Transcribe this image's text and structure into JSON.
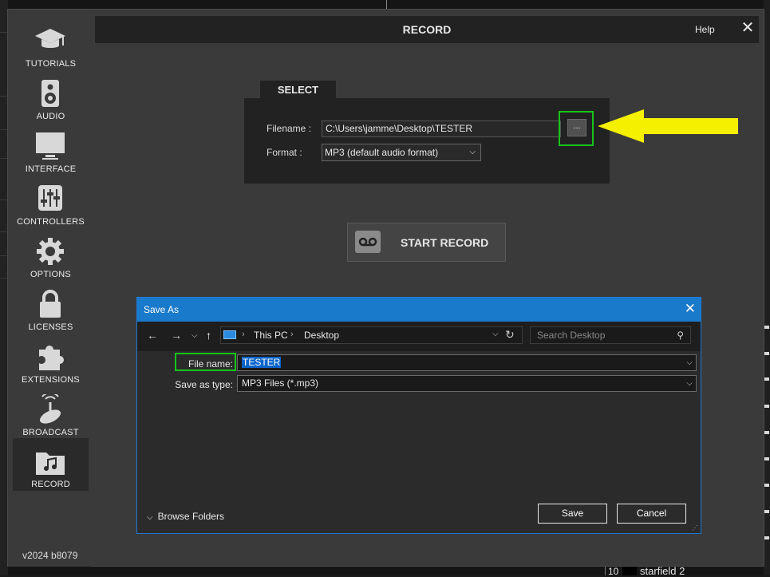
{
  "background": {
    "list_row": {
      "number": "10",
      "name": "starfield 2"
    }
  },
  "settings": {
    "title": "RECORD",
    "help": "Help",
    "close_glyph": "✕",
    "version": "v2024 b8079",
    "sidebar": [
      {
        "label": "TUTORIALS",
        "icon": "graduation-cap-icon"
      },
      {
        "label": "AUDIO",
        "icon": "speaker-icon"
      },
      {
        "label": "INTERFACE",
        "icon": "monitor-icon"
      },
      {
        "label": "CONTROLLERS",
        "icon": "sliders-icon"
      },
      {
        "label": "OPTIONS",
        "icon": "gear-icon"
      },
      {
        "label": "LICENSES",
        "icon": "lock-icon"
      },
      {
        "label": "EXTENSIONS",
        "icon": "puzzle-icon"
      },
      {
        "label": "BROADCAST",
        "icon": "satellite-dish-icon"
      },
      {
        "label": "RECORD",
        "icon": "music-folder-icon",
        "active": true
      }
    ],
    "select": {
      "tab": "SELECT",
      "filename_label": "Filename :",
      "filename_value": "C:\\Users\\jamme\\Desktop\\TESTER",
      "browse_label": "...",
      "format_label": "Format :",
      "format_value": "MP3 (default audio format)"
    },
    "start_record": "START RECORD",
    "annotation_color": "#f5ef00",
    "highlight_color": "#17c41b"
  },
  "save_as": {
    "title": "Save As",
    "close_glyph": "✕",
    "address": [
      "This PC",
      "Desktop"
    ],
    "search_placeholder": "Search Desktop",
    "file_name_label": "File name:",
    "file_name_value": "TESTER",
    "save_type_label": "Save as type:",
    "save_type_value": "MP3 Files (*.mp3)",
    "browse_folders": "Browse Folders",
    "save": "Save",
    "cancel": "Cancel",
    "accent": "#1979ca"
  }
}
